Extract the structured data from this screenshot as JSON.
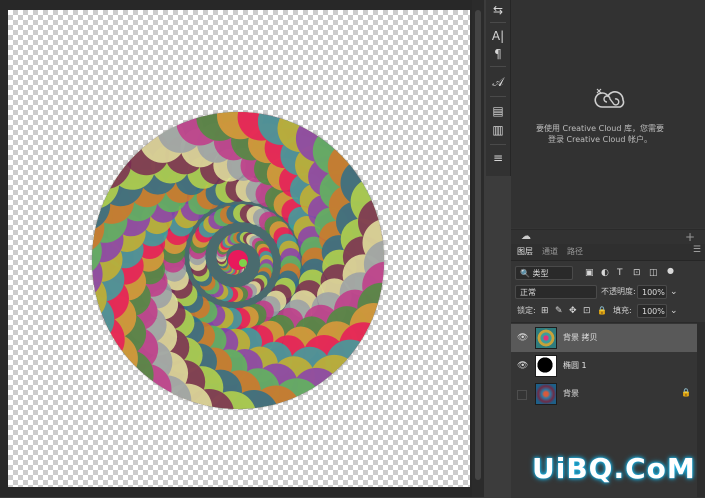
{
  "document": {
    "content": "swirl-artwork"
  },
  "mini_dock": {
    "tools": [
      {
        "icon": "properties-icon",
        "glyph": "⇆"
      },
      {
        "icon": "character-icon",
        "glyph": "A|"
      },
      {
        "icon": "paragraph-icon",
        "glyph": "¶"
      },
      {
        "icon": "glyphs-icon",
        "glyph": "𝒜"
      },
      {
        "icon": "libraries-icon",
        "glyph": "▤"
      },
      {
        "icon": "notes-icon",
        "glyph": "▥"
      },
      {
        "icon": "adjustments-icon",
        "glyph": "≡"
      }
    ]
  },
  "cc_panel": {
    "message": "要使用 Creative Cloud 库，您需要登录 Creative Cloud 帐户。",
    "plus": "+"
  },
  "tabs": [
    {
      "label": "图层",
      "active": true
    },
    {
      "label": "通道",
      "active": false
    },
    {
      "label": "路径",
      "active": false
    }
  ],
  "filter": {
    "kind": "类型",
    "icons": [
      "▣",
      "◐",
      "T",
      "⊡",
      "◫",
      "●"
    ]
  },
  "blend": {
    "mode": "正常",
    "opacity_label": "不透明度:",
    "opacity_value": "100%"
  },
  "lock": {
    "label": "锁定:",
    "icons": [
      "⊞",
      "✎",
      "✥",
      "⊡",
      "🔒"
    ],
    "fill_label": "填充:",
    "fill_value": "100%"
  },
  "layers": [
    {
      "name": "背景 拷贝",
      "visible": true,
      "selected": true,
      "thumb": "swirl"
    },
    {
      "name": "椭圆 1",
      "visible": true,
      "selected": false,
      "thumb": "ellipse-mask"
    },
    {
      "name": "背景",
      "visible": false,
      "selected": false,
      "thumb": "photo",
      "locked": true
    }
  ],
  "watermark": "UiBQ.CoM"
}
